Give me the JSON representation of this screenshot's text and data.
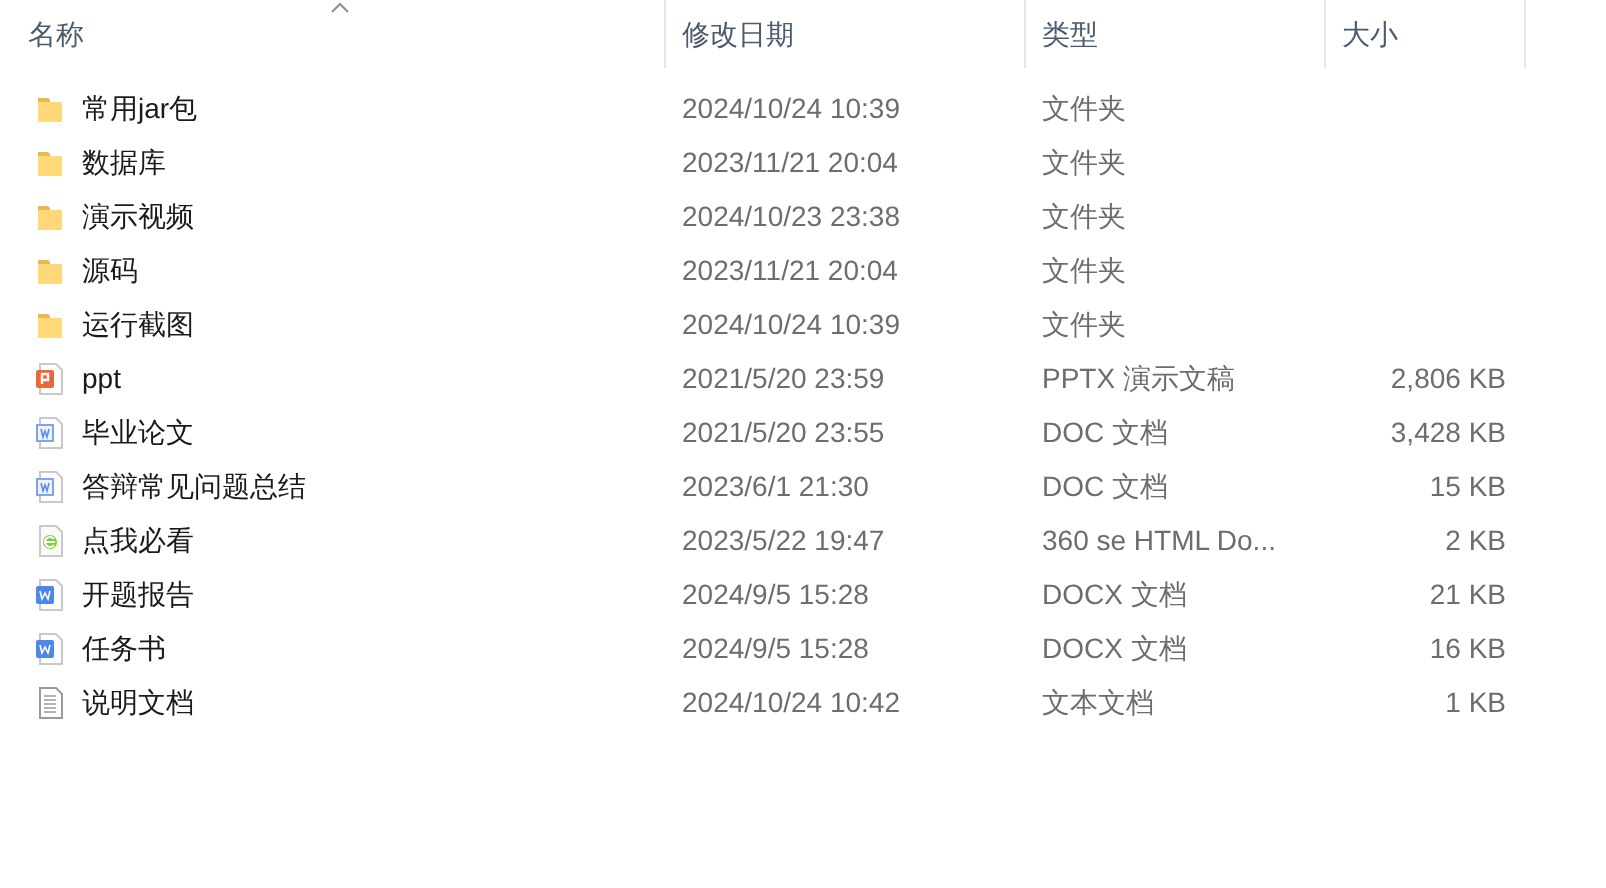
{
  "columns": [
    {
      "label": "名称",
      "sorted": true
    },
    {
      "label": "修改日期",
      "sorted": false
    },
    {
      "label": "类型",
      "sorted": false
    },
    {
      "label": "大小",
      "sorted": false
    }
  ],
  "files": [
    {
      "name": "常用jar包",
      "modified": "2024/10/24 10:39",
      "type": "文件夹",
      "kind": "folder"
    },
    {
      "name": "数据库",
      "modified": "2023/11/21 20:04",
      "type": "文件夹",
      "kind": "folder"
    },
    {
      "name": "演示视频",
      "modified": "2024/10/23 23:38",
      "type": "文件夹",
      "kind": "folder"
    },
    {
      "name": "源码",
      "modified": "2023/11/21 20:04",
      "type": "文件夹",
      "kind": "folder"
    },
    {
      "name": "运行截图",
      "modified": "2024/10/24 10:39",
      "type": "文件夹",
      "kind": "folder"
    },
    {
      "name": "ppt",
      "modified": "2021/5/20 23:59",
      "type": "PPTX 演示文稿",
      "size": "2,806 KB",
      "kind": "pptx"
    },
    {
      "name": "毕业论文",
      "modified": "2021/5/20 23:55",
      "type": "DOC 文档",
      "size": "3,428 KB",
      "kind": "doc"
    },
    {
      "name": "答辩常见问题总结",
      "modified": "2023/6/1 21:30",
      "type": "DOC 文档",
      "size": "15 KB",
      "kind": "doc"
    },
    {
      "name": "点我必看",
      "modified": "2023/5/22 19:47",
      "type": "360 se HTML Do...",
      "size": "2 KB",
      "kind": "html"
    },
    {
      "name": "开题报告",
      "modified": "2024/9/5 15:28",
      "type": "DOCX 文档",
      "size": "21 KB",
      "kind": "docx"
    },
    {
      "name": "任务书",
      "modified": "2024/9/5 15:28",
      "type": "DOCX 文档",
      "size": "16 KB",
      "kind": "docx"
    },
    {
      "name": "说明文档",
      "modified": "2024/10/24 10:42",
      "type": "文本文档",
      "size": "1 KB",
      "kind": "txt"
    }
  ]
}
